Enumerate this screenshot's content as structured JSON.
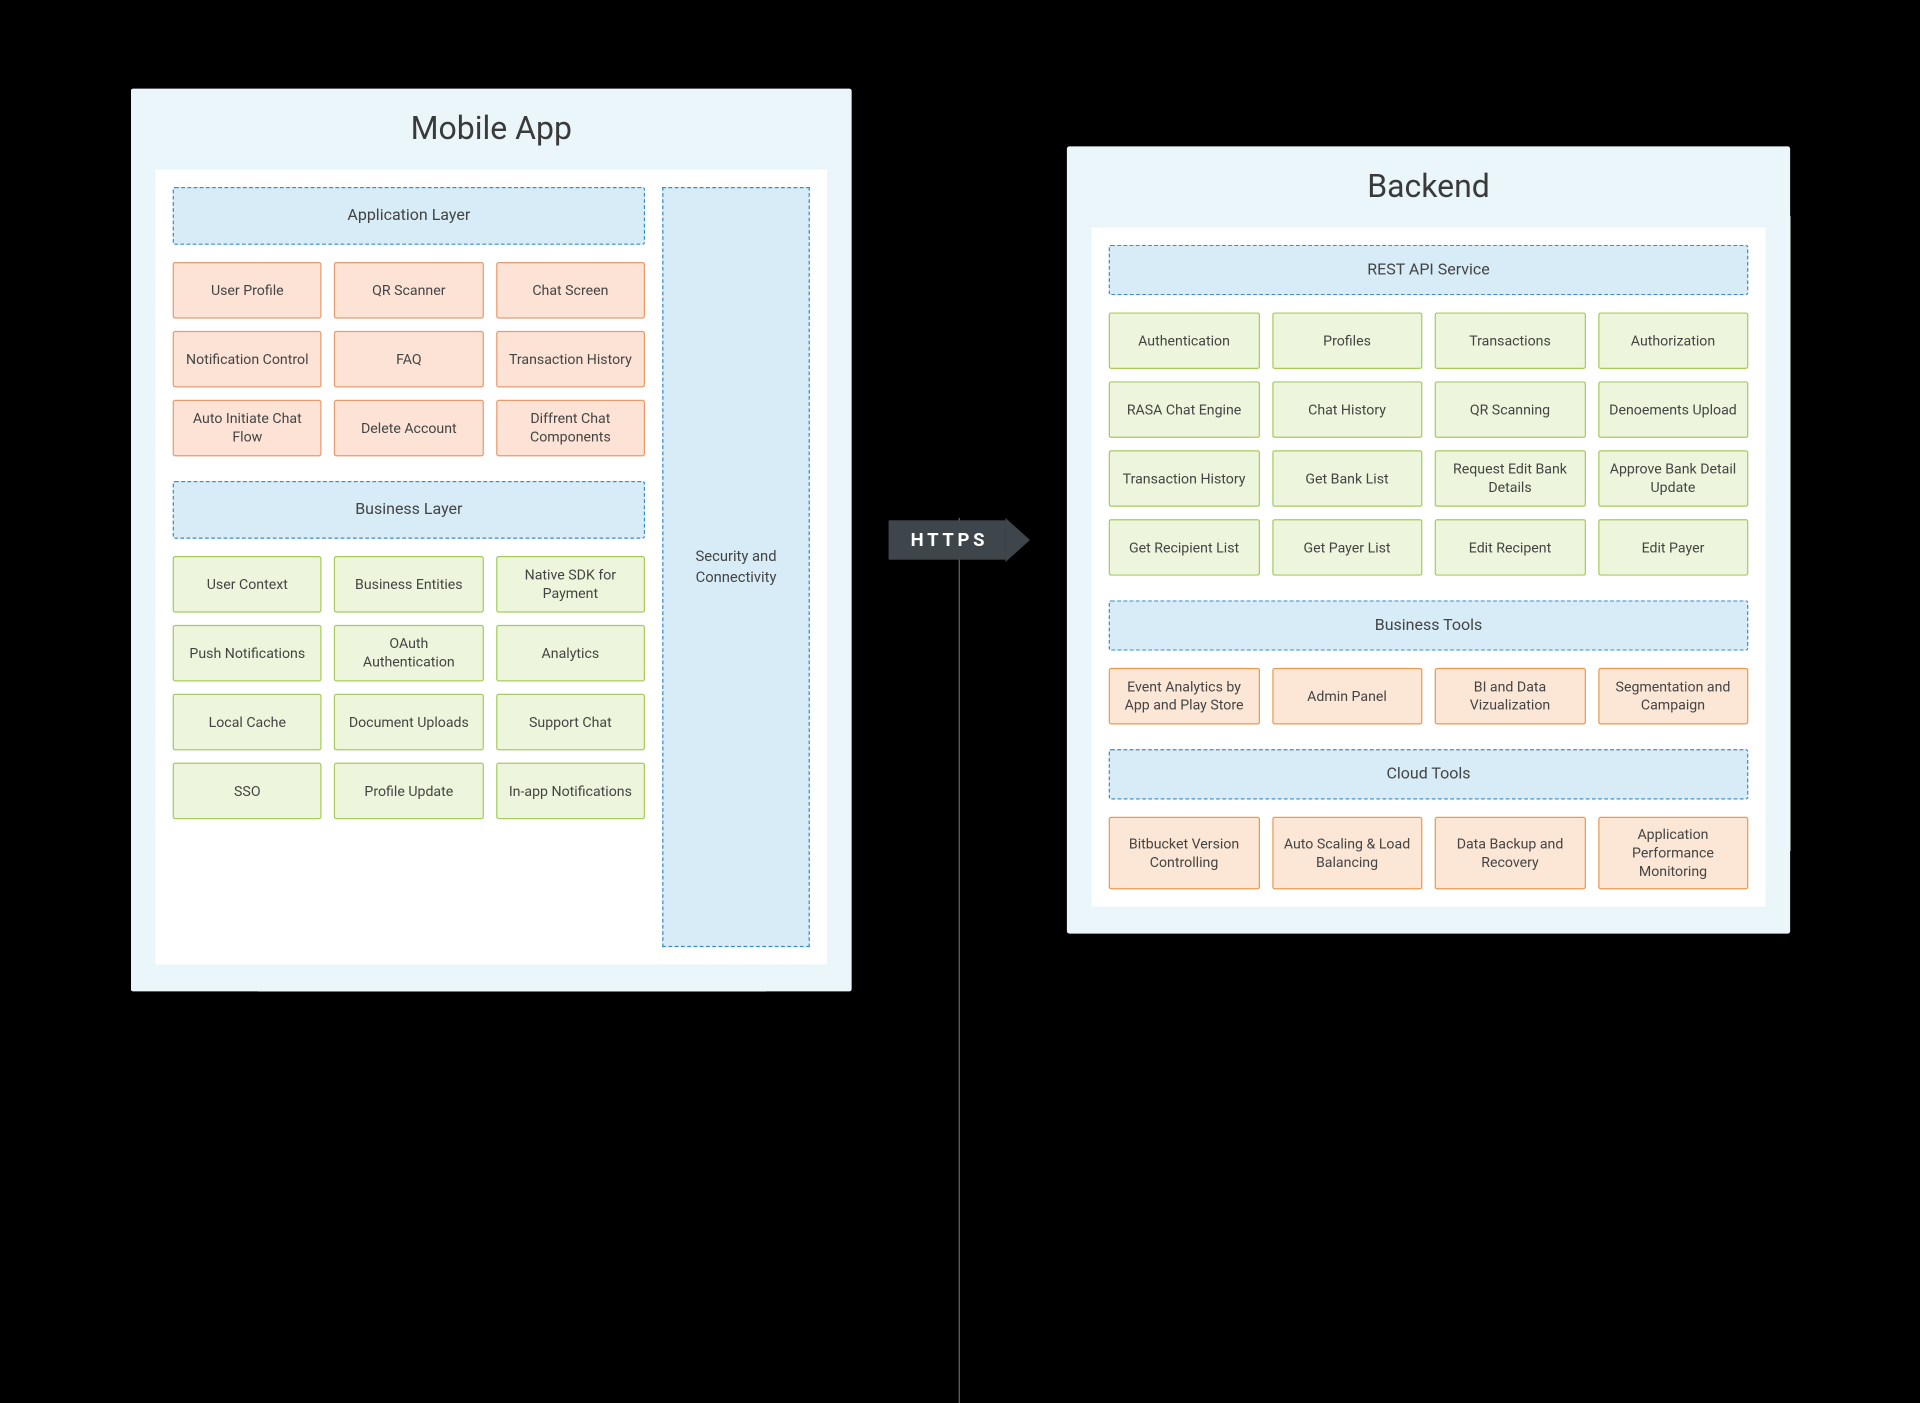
{
  "mobile": {
    "title": "Mobile App",
    "app_layer_label": "Application Layer",
    "app_boxes": [
      "User Profile",
      "QR Scanner",
      "Chat Screen",
      "Notification Control",
      "FAQ",
      "Transaction History",
      "Auto Initiate Chat Flow",
      "Delete Account",
      "Diffrent Chat Components"
    ],
    "biz_layer_label": "Business Layer",
    "biz_boxes": [
      "User Context",
      "Business Entities",
      "Native SDK for Payment",
      "Push Notifications",
      "OAuth Authentication",
      "Analytics",
      "Local Cache",
      "Document Uploads",
      "Support Chat",
      "SSO",
      "Profile Update",
      "In-app Notifications"
    ],
    "security_label": "Security and Connectivity"
  },
  "connector": {
    "label": "HTTPS"
  },
  "backend": {
    "title": "Backend",
    "rest_label": "REST API Service",
    "rest_boxes": [
      "Authentication",
      "Profiles",
      "Transactions",
      "Authorization",
      "RASA Chat Engine",
      "Chat History",
      "QR Scanning",
      "Denoements Upload",
      "Transaction History",
      "Get Bank List",
      "Request Edit Bank Details",
      "Approve Bank Detail Update",
      "Get Recipient List",
      "Get Payer List",
      "Edit Recipent",
      "Edit Payer"
    ],
    "biztools_label": "Business Tools",
    "biztools_boxes": [
      "Event Analytics by App and Play Store",
      "Admin Panel",
      "BI and Data Vizualization",
      "Segmentation and Campaign"
    ],
    "cloud_label": "Cloud Tools",
    "cloud_boxes": [
      "Bitbucket Version Controlling",
      "Auto Scaling & Load Balancing",
      "Data Backup and Recovery",
      "Application Performance Monitoring"
    ]
  }
}
